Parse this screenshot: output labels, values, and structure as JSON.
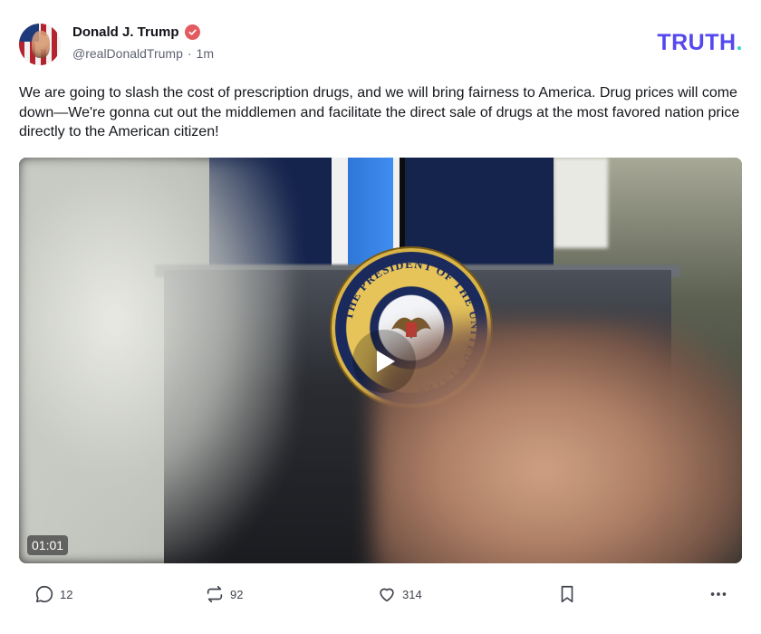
{
  "author": {
    "display_name": "Donald J. Trump",
    "handle": "@realDonaldTrump",
    "separator": "·",
    "time": "1m",
    "verified_color": "#e35a5f"
  },
  "brand": {
    "logo_text": "TRUTH",
    "logo_dot": ".",
    "primary_color": "#5448ee",
    "accent_color": "#31d6c4"
  },
  "post": {
    "text": "We are going to slash the cost of prescription drugs, and we will bring fairness to America. Drug prices will come down—We're gonna cut out the middlemen and facilitate the direct sale of drugs at the most favored nation price directly to the American citizen!"
  },
  "media": {
    "type": "video",
    "duration": "01:01",
    "seal_text": "THE PRESIDENT OF THE UNITED STATES"
  },
  "actions": {
    "replies": "12",
    "reposts": "92",
    "likes": "314",
    "icons": [
      "reply-icon",
      "repost-icon",
      "heart-icon",
      "bookmark-icon",
      "more-icon"
    ]
  }
}
